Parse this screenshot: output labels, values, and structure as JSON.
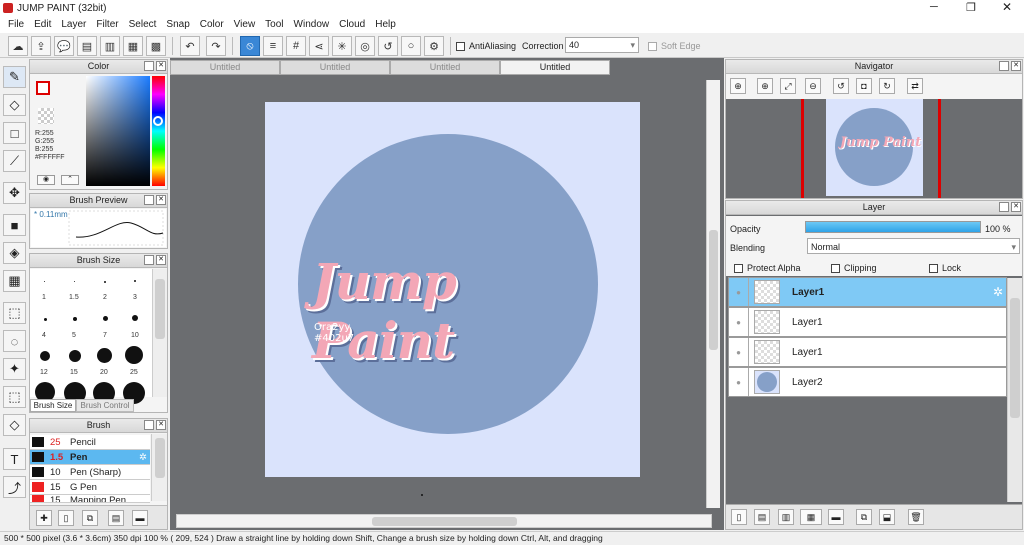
{
  "window": {
    "title": "JUMP PAINT (32bit)"
  },
  "menu": [
    "File",
    "Edit",
    "Layer",
    "Filter",
    "Select",
    "Snap",
    "Color",
    "View",
    "Tool",
    "Window",
    "Cloud",
    "Help"
  ],
  "toolbar": {
    "antialiasing_label": "AntiAliasing",
    "correction_label": "Correction",
    "correction_value": "40",
    "soft_edge_label": "Soft Edge"
  },
  "tabs": [
    "Untitled",
    "Untitled",
    "Untitled",
    "Untitled"
  ],
  "color_panel": {
    "title": "Color",
    "r": "R:255",
    "g": "G:255",
    "b": "B:255",
    "hex": "#FFFFFF"
  },
  "brush_preview": {
    "title": "Brush Preview",
    "size": "0.11mm"
  },
  "brush_size": {
    "title": "Brush Size",
    "rows": [
      [
        "1",
        "1.5",
        "2",
        "3"
      ],
      [
        "4",
        "5",
        "7",
        "10"
      ],
      [
        "12",
        "15",
        "20",
        "25"
      ]
    ],
    "tab_active": "Brush Size",
    "tab_inactive": "Brush Control"
  },
  "brush_panel": {
    "title": "Brush",
    "items": [
      {
        "size": "25",
        "name": "Pencil"
      },
      {
        "size": "1.5",
        "name": "Pen"
      },
      {
        "size": "10",
        "name": "Pen (Sharp)"
      },
      {
        "size": "15",
        "name": "G Pen"
      },
      {
        "size": "15",
        "name": "Mapping Pen"
      }
    ],
    "size_colors": [
      "#d22",
      "#d22",
      "#222",
      "#222",
      "#222"
    ],
    "swatch_colors": [
      "#111",
      "#111",
      "#111",
      "#e22",
      "#e22"
    ]
  },
  "artwork": {
    "logo": "Jump Paint",
    "sig_line1": "Ora2yy",
    "sig_line2": "#402u7"
  },
  "navigator": {
    "title": "Navigator"
  },
  "layer_panel": {
    "title": "Layer",
    "opacity_label": "Opacity",
    "opacity_value": "100 %",
    "opacity_level": 1.0,
    "blending_label": "Blending",
    "blending_value": "Normal",
    "protect_alpha": "Protect Alpha",
    "clipping": "Clipping",
    "lock": "Lock",
    "layers": [
      "Layer1",
      "Layer1",
      "Layer1",
      "Layer2"
    ]
  },
  "status": {
    "text": "500 * 500 pixel   (3.6 * 3.6cm)   350 dpi   100 %   ( 209, 524 )   Draw a straight line by holding down Shift, Change a brush size by holding down Ctrl, Alt, and dragging"
  }
}
